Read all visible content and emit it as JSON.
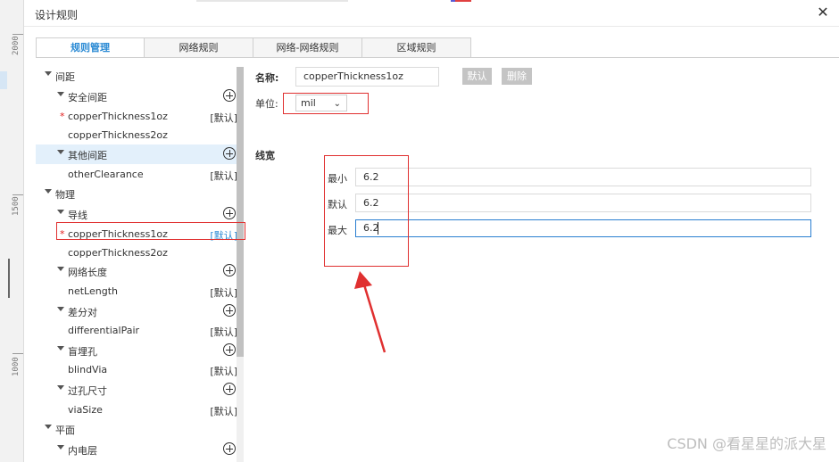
{
  "ruler": {
    "labels": [
      "2000",
      "1500",
      "1000"
    ]
  },
  "dialog": {
    "title": "设计规则",
    "close_icon": "close-icon"
  },
  "tabs": [
    {
      "label": "规则管理",
      "active": true
    },
    {
      "label": "网络规则",
      "active": false
    },
    {
      "label": "网络-网络规则",
      "active": false
    },
    {
      "label": "区域规则",
      "active": false
    }
  ],
  "tree": {
    "spacing": "间距",
    "safe_spacing": "安全间距",
    "safe_rule_1": "copperThickness1oz",
    "safe_rule_1_tag": "[默认]",
    "safe_rule_2": "copperThickness2oz",
    "other_spacing": "其他间距",
    "other_rule": "otherClearance",
    "other_rule_tag": "[默认]",
    "physical": "物理",
    "track": "导线",
    "track_rule_1": "copperThickness1oz",
    "track_rule_1_tag": "[默认]",
    "track_rule_2": "copperThickness2oz",
    "net_length": "网络长度",
    "net_length_rule": "netLength",
    "net_length_rule_tag": "[默认]",
    "diff_pair": "差分对",
    "diff_pair_rule": "differentialPair",
    "diff_pair_rule_tag": "[默认]",
    "blind_via": "盲埋孔",
    "blind_via_rule": "blindVia",
    "blind_via_rule_tag": "[默认]",
    "via_size": "过孔尺寸",
    "via_size_rule": "viaSize",
    "via_size_rule_tag": "[默认]",
    "plane": "平面",
    "inner_layer": "内电层",
    "required_marker": "*"
  },
  "form": {
    "name_label": "名称:",
    "name_value": "copperThickness1oz",
    "default_button": "默认",
    "delete_button": "删除",
    "unit_label": "单位:",
    "unit_value": "mil",
    "width_section": "线宽",
    "min_label": "最小",
    "min_value": "6.2",
    "default_label": "默认",
    "default_value": "6.2",
    "max_label": "最大",
    "max_value": "6.2"
  },
  "annotation": {
    "color": "#e03030"
  },
  "accent_color": "#2a8ad4",
  "watermark": "CSDN @看星星的派大星"
}
